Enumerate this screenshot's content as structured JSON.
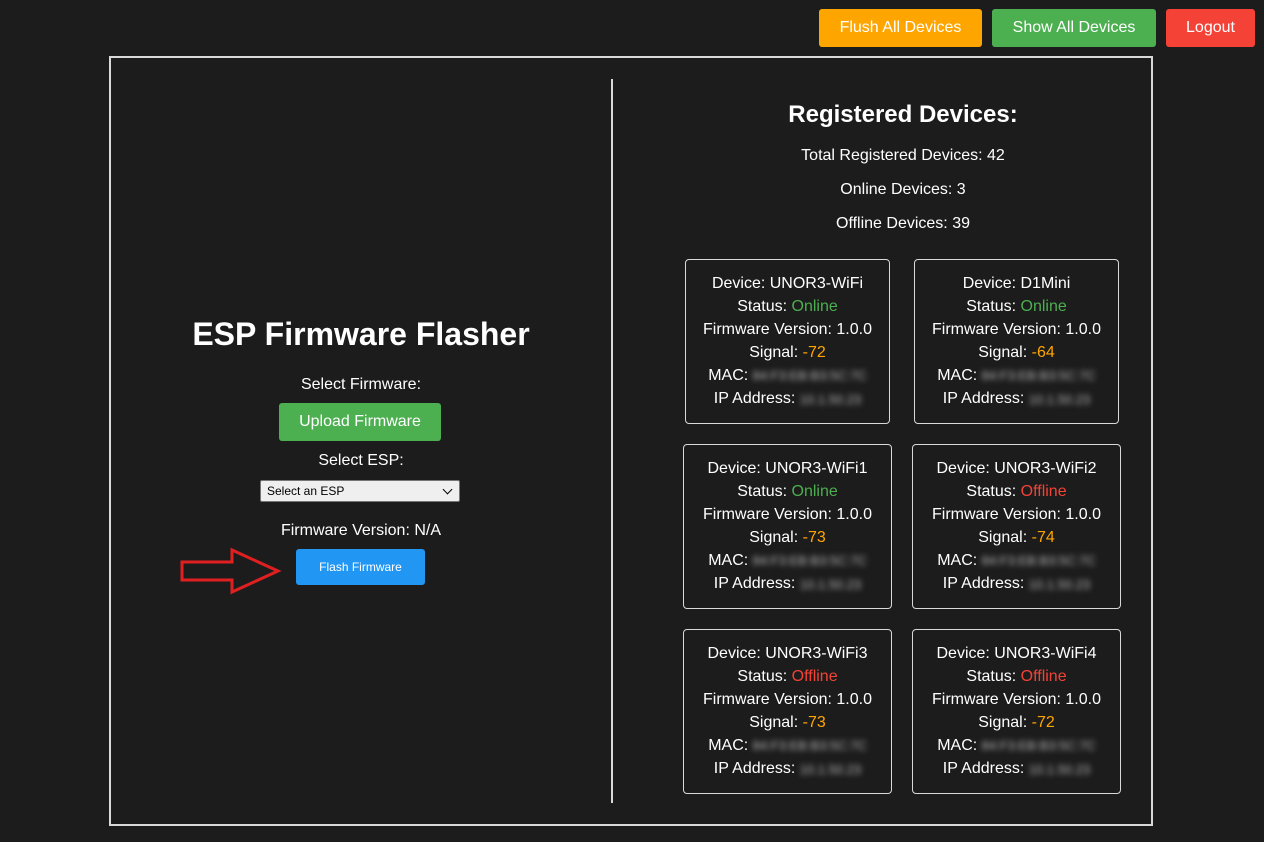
{
  "topbar": {
    "flush_label": "Flush All Devices",
    "show_label": "Show All Devices",
    "logout_label": "Logout",
    "flush_color": "#ffa500",
    "show_color": "#4caf50",
    "logout_color": "#f44336"
  },
  "flasher": {
    "title": "ESP Firmware Flasher",
    "select_firmware_label": "Select Firmware:",
    "upload_label": "Upload Firmware",
    "select_esp_label": "Select ESP:",
    "esp_select_value": "Select an ESP",
    "firmware_version_label": "Firmware Version: N/A",
    "flash_label": "Flash Firmware"
  },
  "registry": {
    "title": "Registered Devices:",
    "total": "Total Registered Devices: 42",
    "online": "Online Devices: 3",
    "offline": "Offline Devices: 39"
  },
  "labels": {
    "device": "Device: ",
    "status": "Status: ",
    "firmware": "Firmware Version: ",
    "signal": "Signal: ",
    "mac": "MAC: ",
    "ip": "IP Address: "
  },
  "devices": [
    {
      "name": "UNOR3-WiFi",
      "status": "Online",
      "firmware": "1.0.0",
      "signal": "-72",
      "mac": "84:F3:EB:B3:5C:7C",
      "ip": "10.1.50.23"
    },
    {
      "name": "D1Mini",
      "status": "Online",
      "firmware": "1.0.0",
      "signal": "-64",
      "mac": "84:F3:EB:B3:5C:7C",
      "ip": "10.1.50.23"
    },
    {
      "name": "UNOR3-WiFi1",
      "status": "Online",
      "firmware": "1.0.0",
      "signal": "-73",
      "mac": "84:F3:EB:B3:5C:7C",
      "ip": "10.1.50.23"
    },
    {
      "name": "UNOR3-WiFi2",
      "status": "Offline",
      "firmware": "1.0.0",
      "signal": "-74",
      "mac": "84:F3:EB:B3:5C:7C",
      "ip": "10.1.50.23"
    },
    {
      "name": "UNOR3-WiFi3",
      "status": "Offline",
      "firmware": "1.0.0",
      "signal": "-73",
      "mac": "84:F3:EB:B3:5C:7C",
      "ip": "10.1.50.23"
    },
    {
      "name": "UNOR3-WiFi4",
      "status": "Offline",
      "firmware": "1.0.0",
      "signal": "-72",
      "mac": "84:F3:EB:B3:5C:7C",
      "ip": "10.1.50.23"
    }
  ],
  "colors": {
    "background": "#1c1c1c",
    "online": "#4caf50",
    "offline": "#f44336",
    "signal": "#ffa500",
    "flash_button": "#2196f3",
    "annotation_arrow": "#e02020"
  }
}
